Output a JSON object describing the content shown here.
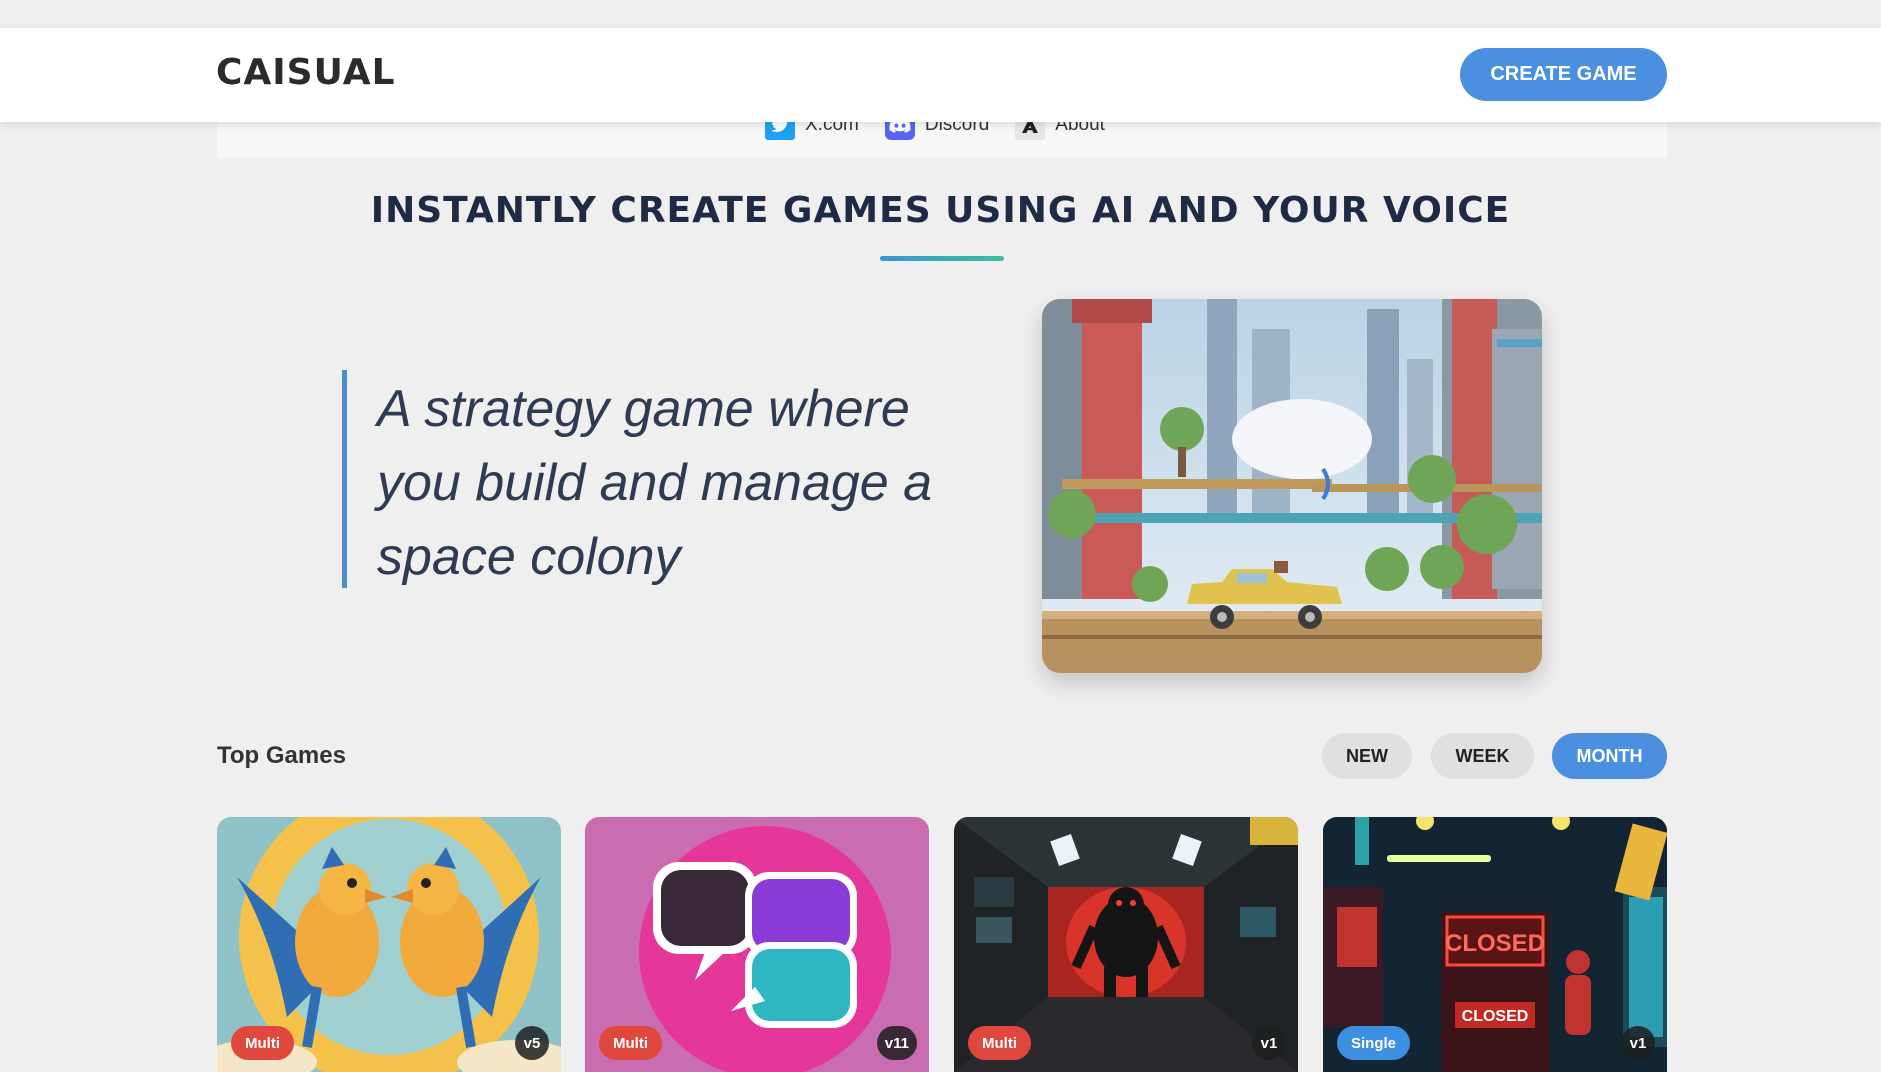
{
  "header": {
    "logo": "CAISUAL",
    "create_button": "CREATE GAME"
  },
  "links": [
    {
      "label": "X.com",
      "icon": "twitter-bird-icon"
    },
    {
      "label": "Discord",
      "icon": "discord-icon"
    },
    {
      "label": "About",
      "icon": "about-a-icon"
    }
  ],
  "hero": {
    "title": "INSTANTLY CREATE GAMES USING AI AND YOUR VOICE",
    "prompt": "A strategy game where you build and manage a space colony"
  },
  "top_games": {
    "title": "Top Games",
    "filters": [
      "NEW",
      "WEEK",
      "MONTH"
    ],
    "active_filter": "MONTH",
    "cards": [
      {
        "mode": "Multi",
        "version": "v5",
        "art": "two-birds"
      },
      {
        "mode": "Multi",
        "version": "v11",
        "art": "chat-bubbles"
      },
      {
        "mode": "Multi",
        "version": "v1",
        "art": "monster-corridor"
      },
      {
        "mode": "Single",
        "version": "v1",
        "art": "closed-arcade",
        "sign_main": "CLOSED",
        "sign_small": "CLOSED"
      }
    ]
  },
  "colors": {
    "accent": "#4a8fe0",
    "multi_badge": "#e0473d",
    "single_badge": "#3d8fe0",
    "title_text": "#1f2a44"
  }
}
